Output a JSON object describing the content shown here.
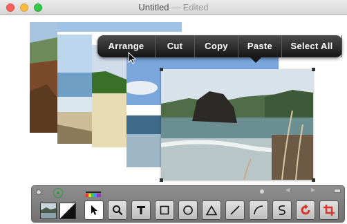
{
  "window": {
    "title": "Untitled",
    "title_separator": " — ",
    "title_status": "Edited"
  },
  "context_menu": {
    "items": [
      "Arrange",
      "Cut",
      "Copy",
      "Paste",
      "Select All"
    ]
  },
  "toolbar": {
    "tools": [
      "pointer-tool",
      "zoom-tool",
      "text-tool",
      "rectangle-tool",
      "oval-tool",
      "triangle-tool",
      "line-tool",
      "curve-tool",
      "freehand-tool",
      "rotate-tool",
      "crop-tool"
    ],
    "selected_tool": "pointer-tool"
  },
  "colors": {
    "menu_bg": "#1c1c1c",
    "menu_text": "#ffffff",
    "toolbar_bg": "#808080",
    "close": "#fc605c",
    "minimize": "#fdbc40",
    "zoom": "#34c84a",
    "rotate_tool": "#d9342b",
    "crop_tool": "#d9342b",
    "green_button": "#2e9b3b"
  }
}
